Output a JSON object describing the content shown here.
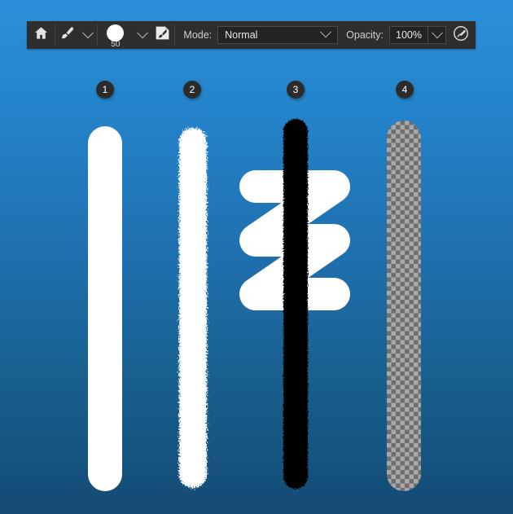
{
  "app": {
    "background_top_color": "#2b90d9",
    "background_bottom_color": "#144b74",
    "toolbar_color": "#2e2e2e"
  },
  "toolbar": {
    "home_icon": "home-icon",
    "brush_tool_icon": "paintbrush-icon",
    "brush_tool_caret": "chevron-down-icon",
    "brush_size_value": "50",
    "brush_size_caret": "chevron-down-icon",
    "brush_preset_icon": "brush-preset-icon",
    "mode_label": "Mode:",
    "mode_value": "Normal",
    "mode_caret": "chevron-down-icon",
    "opacity_label": "Opacity:",
    "opacity_value": "100%",
    "opacity_caret": "chevron-down-icon",
    "airbrush_icon": "airbrush-icon"
  },
  "badges": [
    {
      "label": "1"
    },
    {
      "label": "2"
    },
    {
      "label": "3"
    },
    {
      "label": "4"
    }
  ],
  "strokes": [
    {
      "name": "solid-white-stroke",
      "color": "#ffffff"
    },
    {
      "name": "rough-edge-white-stroke",
      "color": "#ffffff"
    },
    {
      "name": "black-over-white-zigzag-stroke",
      "color": "#000000",
      "under_color": "#ffffff"
    },
    {
      "name": "eraser-transparency-stroke",
      "checker_light": "#a8a8a8",
      "checker_dark": "#6e6e6e"
    }
  ]
}
